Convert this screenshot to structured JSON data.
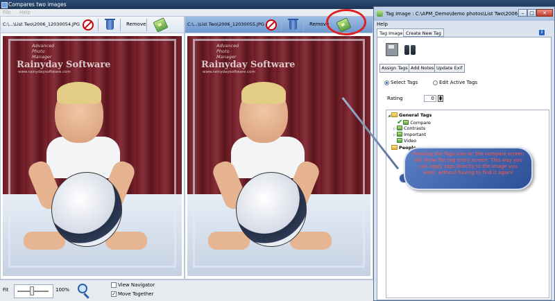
{
  "window": {
    "title": "Compares two images"
  },
  "menu": {
    "items": [
      "File",
      "Help"
    ]
  },
  "left_pane": {
    "filename": "C:\\...\\List Two\\2006_12030054.JPG",
    "remove_label": "Remove"
  },
  "right_pane": {
    "filename": "C:\\...\\List Two\\2006_12030055.JPG",
    "remove_label": "Remove"
  },
  "watermark": {
    "line1": "Advanced",
    "line2": "Photo",
    "line3": "Manager",
    "brand": "Rainyday Software",
    "url": "www.rainydaysoftware.com"
  },
  "bottom": {
    "fit_label": "Fit",
    "zoom_value": "100%",
    "view_navigator_label": "View Navigator",
    "view_navigator_checked": false,
    "move_together_label": "Move Together",
    "move_together_checked": true
  },
  "dialog": {
    "title": "Tag Image : C:\\APM_Demo\\demo photos\\List Two\\2006_...",
    "menu_help": "Help",
    "tabs": [
      "Tag Image",
      "Create New Tag"
    ],
    "buttons": {
      "assign": "Assign Tags",
      "add_notes": "Add Notes",
      "update_exif": "Update Exif"
    },
    "radios": {
      "select_tags": "Select Tags",
      "edit_active": "Edit Active Tags"
    },
    "rating_label": "Rating",
    "rating_value": "0",
    "tree": {
      "general": "General Tags",
      "items": [
        "Compare",
        "Contrasts",
        "Important",
        "Video"
      ],
      "people": "People"
    }
  },
  "callout": {
    "text": "Pressing the Tags icon on the compare screen will show the tag entry screen. This way you can apply tags directly to the image you want, without having to find it again!"
  },
  "colors": {
    "callout_text": "#ff5a4a",
    "highlight_circle": "#e02020",
    "active_toolbar": "#6e98cf"
  }
}
